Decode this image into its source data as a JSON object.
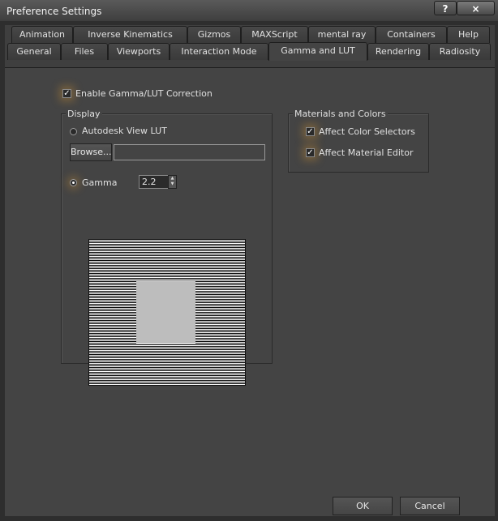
{
  "window": {
    "title": "Preference Settings",
    "help_label": "?",
    "close_label": "×"
  },
  "tabs": {
    "row1": [
      "Animation",
      "Inverse Kinematics",
      "Gizmos",
      "MAXScript",
      "mental ray",
      "Containers",
      "Help"
    ],
    "row2": [
      "General",
      "Files",
      "Viewports",
      "Interaction Mode",
      "Gamma and LUT",
      "Rendering",
      "Radiosity"
    ],
    "active": "Gamma and LUT"
  },
  "enable": {
    "label": "Enable Gamma/LUT Correction",
    "checked": true
  },
  "display": {
    "group_label": "Display",
    "lut_label": "Autodesk View LUT",
    "browse_label": "Browse...",
    "lut_path": "",
    "gamma_label": "Gamma",
    "gamma_value": "2.2",
    "gamma_selected": true
  },
  "materials": {
    "group_label": "Materials and Colors",
    "color_selectors_label": "Affect Color Selectors",
    "color_selectors_checked": true,
    "material_editor_label": "Affect Material Editor",
    "material_editor_checked": true
  },
  "footer": {
    "ok_label": "OK",
    "cancel_label": "Cancel"
  },
  "colors": {
    "panel_bg": "#444444",
    "highlight_glow": "#d69632"
  }
}
